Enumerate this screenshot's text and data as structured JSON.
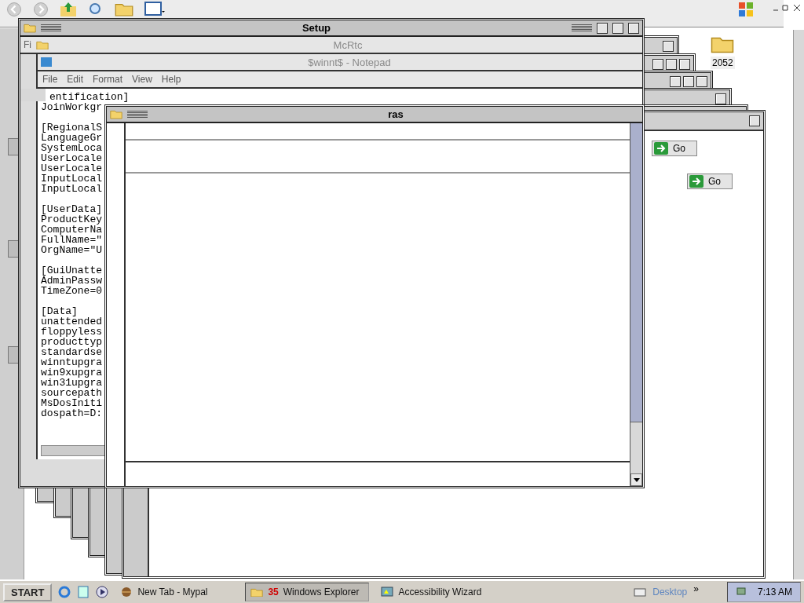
{
  "explorer": {
    "folder_label": "2052"
  },
  "setup_window": {
    "title": "Setup",
    "partial_menu": "Fi",
    "ghost_title": "McRtc"
  },
  "notepad": {
    "ghost_title": "$winnt$ - Notepad",
    "menu": [
      "File",
      "Edit",
      "Format",
      "View",
      "Help"
    ],
    "sections": [
      [
        "entification]",
        "JoinWorkgr"
      ],
      [
        "[RegionalS",
        "LanguageGr",
        "SystemLoca",
        "UserLocale",
        "UserLocale",
        "InputLocal",
        "InputLocal"
      ],
      [
        "[UserData]",
        "ProductKey",
        "ComputerNa",
        "FullName=\"",
        "OrgName=\"U"
      ],
      [
        "[GuiUnatte",
        "AdminPassw",
        "TimeZone=0"
      ],
      [
        "[Data]",
        "unattended",
        "floppyless",
        "producttyp",
        "standardse",
        "winntupgra",
        "win9xupgra",
        "win31upgra",
        "sourcepath",
        "MsDosIniti",
        "dospath=D:"
      ]
    ]
  },
  "ras_window": {
    "title": "ras"
  },
  "go_buttons": [
    "Go",
    "Go"
  ],
  "taskbar": {
    "start": "START",
    "tasks": [
      {
        "kind": "browser",
        "label": "New Tab - Mypal",
        "selected": false
      },
      {
        "kind": "folder",
        "count": "35",
        "label": "Windows Explorer",
        "selected": true
      },
      {
        "kind": "wizard",
        "label": "Accessibility Wizard",
        "selected": false
      }
    ],
    "toolbar_label": "Desktop",
    "chevron": "»",
    "clock": "7:13 AM"
  }
}
